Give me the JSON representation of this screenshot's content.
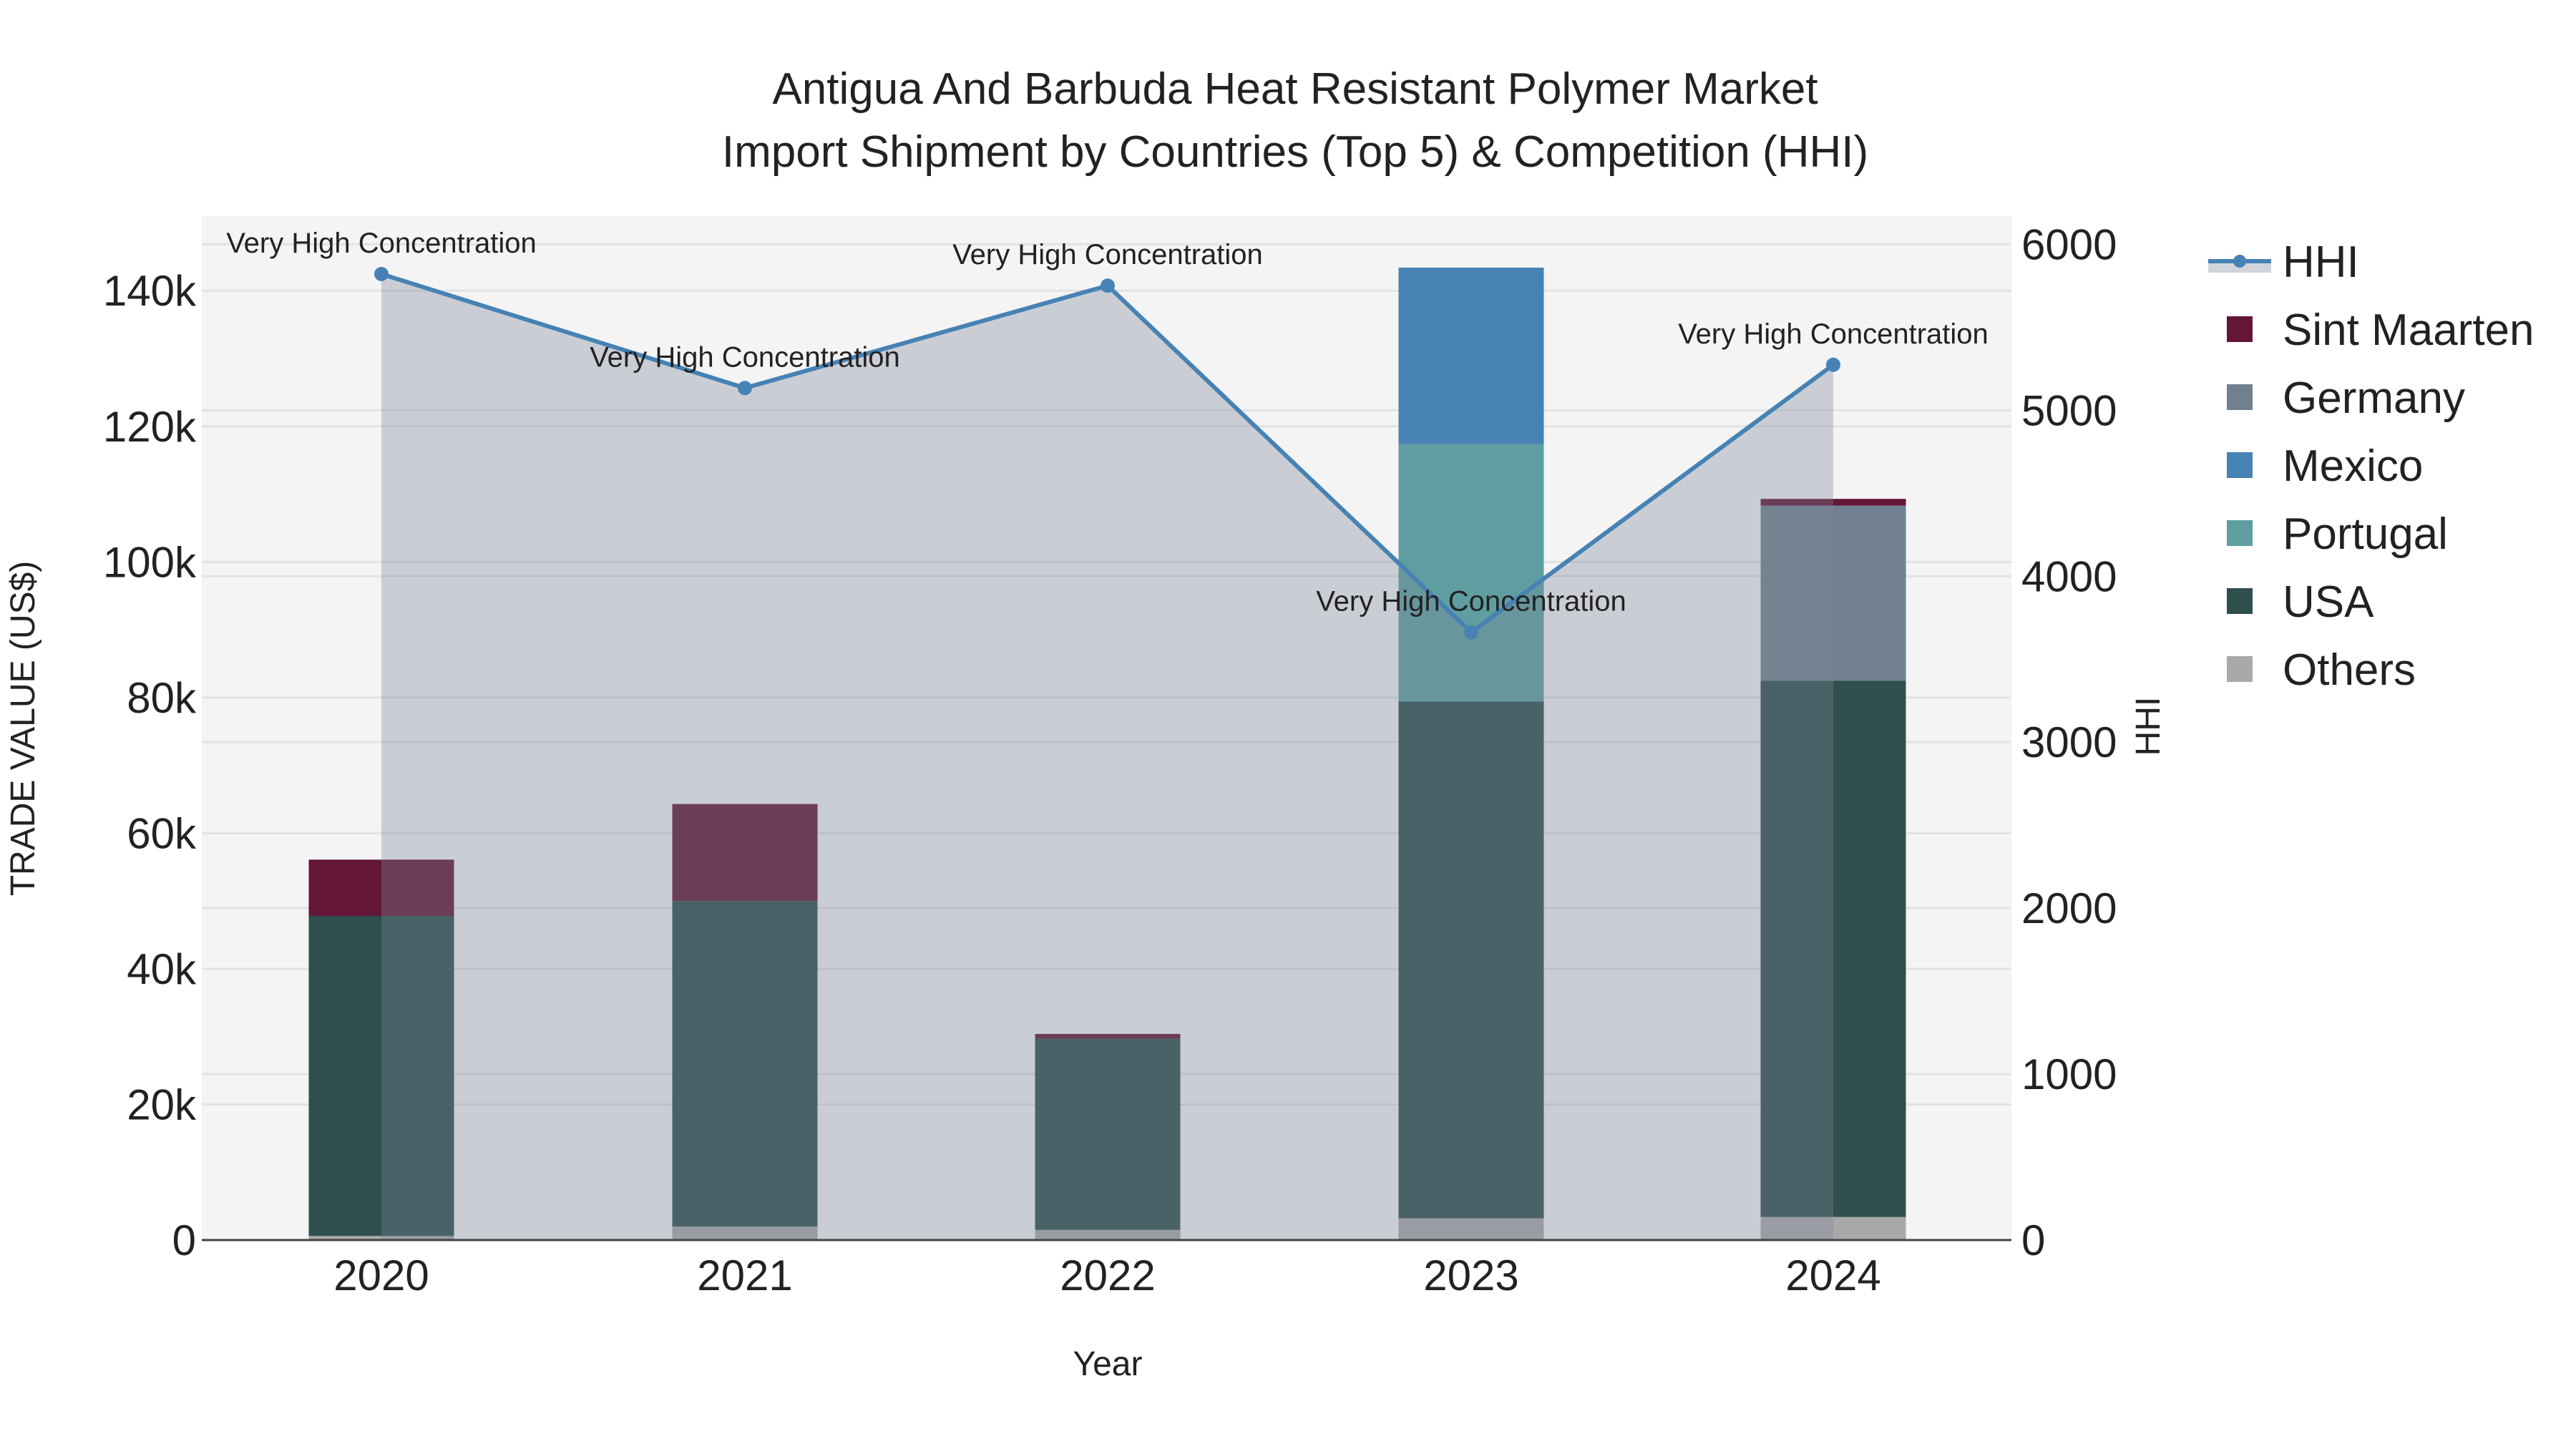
{
  "chart_data": {
    "type": "bar",
    "title_line1": "Antigua And Barbuda Heat Resistant Polymer Market",
    "title_line2": "Import Shipment by Countries (Top 5) & Competition (HHI)",
    "xlabel": "Year",
    "ylabel": "TRADE VALUE (US$)",
    "y2label": "HHI",
    "categories": [
      "2020",
      "2021",
      "2022",
      "2023",
      "2024"
    ],
    "ylim": [
      0,
      151000
    ],
    "y2lim": [
      0,
      6170
    ],
    "yticks": [
      0,
      20000,
      40000,
      60000,
      80000,
      100000,
      120000,
      140000
    ],
    "ytick_labels": [
      "0",
      "20k",
      "40k",
      "60k",
      "80k",
      "100k",
      "120k",
      "140k"
    ],
    "y2ticks": [
      0,
      1000,
      2000,
      3000,
      4000,
      5000,
      6000
    ],
    "y2tick_labels": [
      "0",
      "1000",
      "2000",
      "3000",
      "4000",
      "5000",
      "6000"
    ],
    "stack_order": [
      "Others",
      "USA",
      "Portugal",
      "Mexico",
      "Germany",
      "Sint Maarten"
    ],
    "series": [
      {
        "name": "Sint Maarten",
        "color": "#641637",
        "values": [
          8300,
          14300,
          700,
          0,
          1000
        ]
      },
      {
        "name": "Germany",
        "color": "#708090",
        "values": [
          0,
          0,
          0,
          0,
          25800
        ]
      },
      {
        "name": "Mexico",
        "color": "#4682B4",
        "values": [
          0,
          0,
          0,
          26000,
          0
        ]
      },
      {
        "name": "Portugal",
        "color": "#5F9EA0",
        "values": [
          0,
          0,
          0,
          38000,
          0
        ]
      },
      {
        "name": "USA",
        "color": "#2F4F4F",
        "values": [
          47200,
          48000,
          28200,
          76200,
          79100
        ]
      },
      {
        "name": "Others",
        "color": "#A9A9A9",
        "values": [
          600,
          2000,
          1500,
          3200,
          3400
        ]
      }
    ],
    "hhi": {
      "name": "HHI",
      "color": "#4682B4",
      "values": [
        5821,
        5134,
        5751,
        3662,
        5274
      ],
      "annotations": [
        "Very High Concentration",
        "Very High Concentration",
        "Very High Concentration",
        "Very High Concentration",
        "Very High Concentration"
      ]
    },
    "legend_order": [
      "HHI",
      "Sint Maarten",
      "Germany",
      "Mexico",
      "Portugal",
      "USA",
      "Others"
    ],
    "legend_position": "right",
    "grid": true
  }
}
